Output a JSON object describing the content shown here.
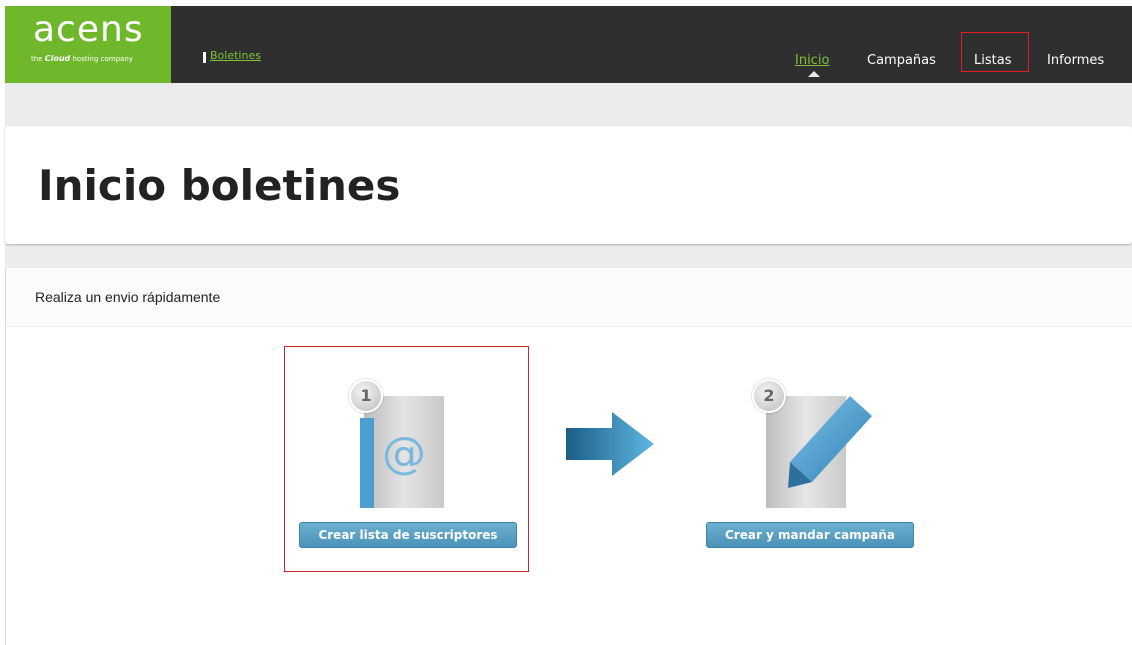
{
  "logo": {
    "word": "acens",
    "tagline_pre": "the ",
    "tagline_cloud": "Cloud",
    "tagline_post": " hosting company"
  },
  "breadcrumb": {
    "label": "Boletines"
  },
  "nav": {
    "items": [
      {
        "label": "Inicio",
        "active": true
      },
      {
        "label": "Campañas",
        "active": false
      },
      {
        "label": "Listas",
        "active": false
      },
      {
        "label": "Informes",
        "active": false
      }
    ]
  },
  "page": {
    "title": "Inicio boletines"
  },
  "quick_send": {
    "heading": "Realiza un envio rápidamente",
    "steps": [
      {
        "number": "1",
        "button_label": "Crear lista de suscriptores",
        "icon": "address-book-icon"
      },
      {
        "number": "2",
        "button_label": "Crear y mandar campaña",
        "icon": "pencil-document-icon"
      }
    ]
  },
  "colors": {
    "brand_green": "#6fb82c",
    "topbar": "#2f2f2f",
    "highlight_red": "#c0272d",
    "button_blue": "#4a93b8"
  }
}
